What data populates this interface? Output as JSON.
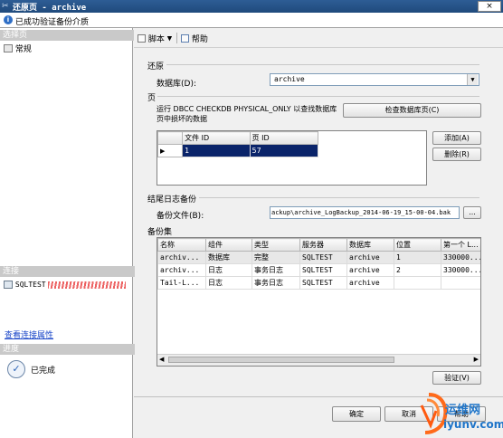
{
  "window": {
    "title": "还原页 - archive",
    "close_label": "×"
  },
  "infobar": {
    "message": "已成功验证备份介质"
  },
  "left": {
    "select_page_header": "选择页",
    "pages": [
      {
        "label": "常规"
      }
    ],
    "connection_header": "连接",
    "server_name": "SQLTEST",
    "view_connection_link": "查看连接属性",
    "progress_header": "进度",
    "progress_status": "已完成"
  },
  "toolbar": {
    "script_label": "脚本",
    "help_label": "帮助"
  },
  "restore": {
    "section_label": "还原",
    "database_label": "数据库(D):",
    "database_value": "archive"
  },
  "pages_section": {
    "label": "页",
    "description": "运行 DBCC CHECKDB PHYSICAL_ONLY 以查找数据库页中损坏的数据",
    "check_button": "检查数据库页(C)",
    "add_button": "添加(A)",
    "remove_button": "删除(R)",
    "columns": [
      "文件 ID",
      "页 ID"
    ],
    "rows": [
      {
        "file_id": "1",
        "page_id": "57"
      }
    ]
  },
  "tail_log": {
    "section_label": "结尾日志备份",
    "file_label": "备份文件(B):",
    "file_value": "ackup\\archive_LogBackup_2014-06-19_15-00-04.bak",
    "browse_label": "..."
  },
  "backup_sets": {
    "label": "备份集",
    "columns": [
      "名称",
      "组件",
      "类型",
      "服务器",
      "数据库",
      "位置",
      "第一个 L..."
    ],
    "rows": [
      {
        "name": "archiv...",
        "component": "数据库",
        "type": "完整",
        "server": "SQLTEST",
        "database": "archive",
        "position": "1",
        "first_lsn": "330000..."
      },
      {
        "name": "archiv...",
        "component": "日志",
        "type": "事务日志",
        "server": "SQLTEST",
        "database": "archive",
        "position": "2",
        "first_lsn": "330000..."
      },
      {
        "name": "Tail-L...",
        "component": "日志",
        "type": "事务日志",
        "server": "SQLTEST",
        "database": "archive",
        "position": "",
        "first_lsn": ""
      }
    ],
    "verify_button": "验证(V)"
  },
  "footer": {
    "ok_button": "确定",
    "cancel_button": "取消",
    "help_button": "帮助"
  },
  "watermark": {
    "site": "运维网",
    "url": "iyunv.com"
  }
}
